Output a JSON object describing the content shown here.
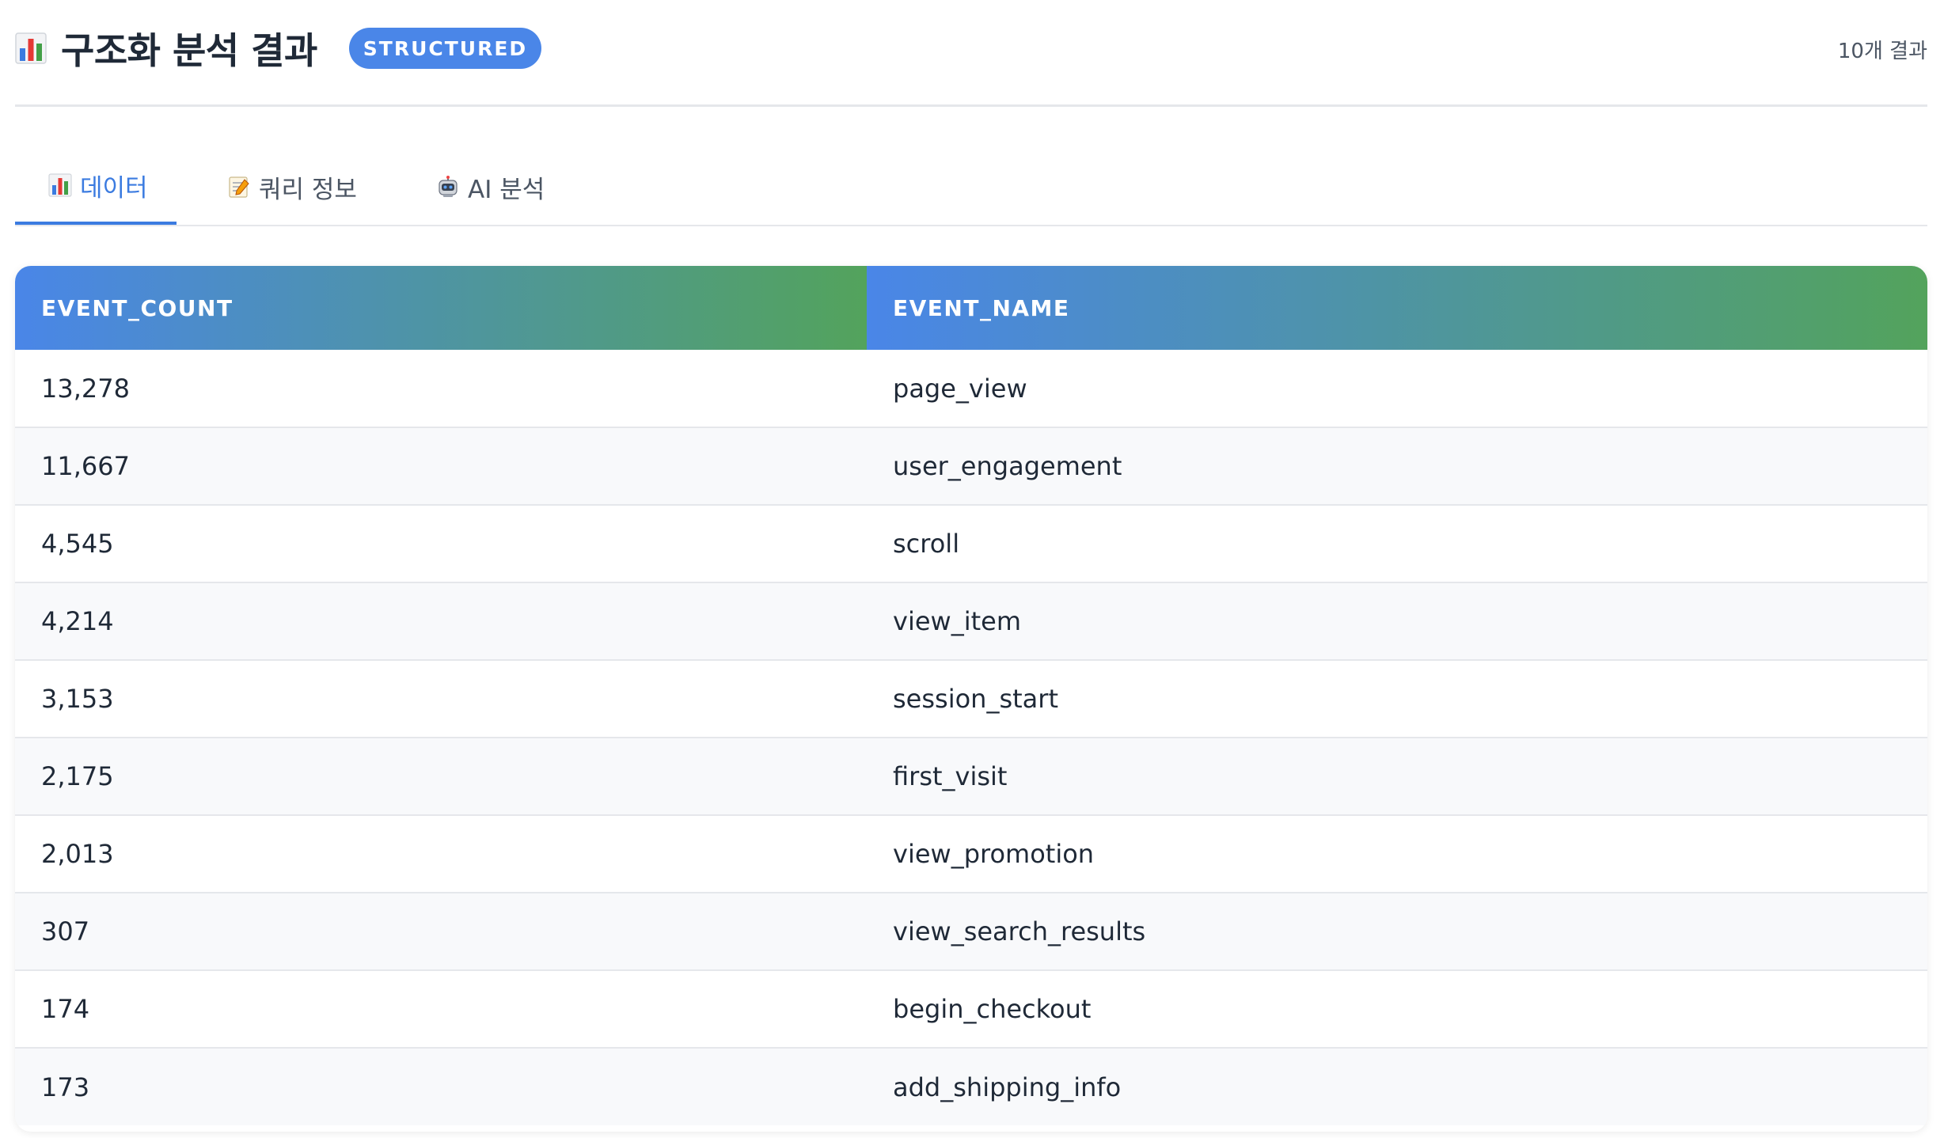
{
  "header": {
    "title": "구조화 분석 결과",
    "title_icon": "bar-chart-emoji",
    "badge": "STRUCTURED",
    "result_count": "10개 결과"
  },
  "tabs": [
    {
      "label": "데이터",
      "icon": "bar-chart-emoji",
      "active": true
    },
    {
      "label": "쿼리 정보",
      "icon": "memo-emoji",
      "active": false
    },
    {
      "label": "AI 분석",
      "icon": "robot-emoji",
      "active": false
    }
  ],
  "table": {
    "columns": [
      "EVENT_COUNT",
      "EVENT_NAME"
    ],
    "rows": [
      [
        "13,278",
        "page_view"
      ],
      [
        "11,667",
        "user_engagement"
      ],
      [
        "4,545",
        "scroll"
      ],
      [
        "4,214",
        "view_item"
      ],
      [
        "3,153",
        "session_start"
      ],
      [
        "2,175",
        "first_visit"
      ],
      [
        "2,013",
        "view_promotion"
      ],
      [
        "307",
        "view_search_results"
      ],
      [
        "174",
        "begin_checkout"
      ],
      [
        "173",
        "add_shipping_info"
      ]
    ]
  },
  "colors": {
    "accent": "#3b7be0",
    "badge": "#4a86e8",
    "header_gradient_start": "#4a86e8",
    "header_gradient_end": "#53a35c"
  }
}
